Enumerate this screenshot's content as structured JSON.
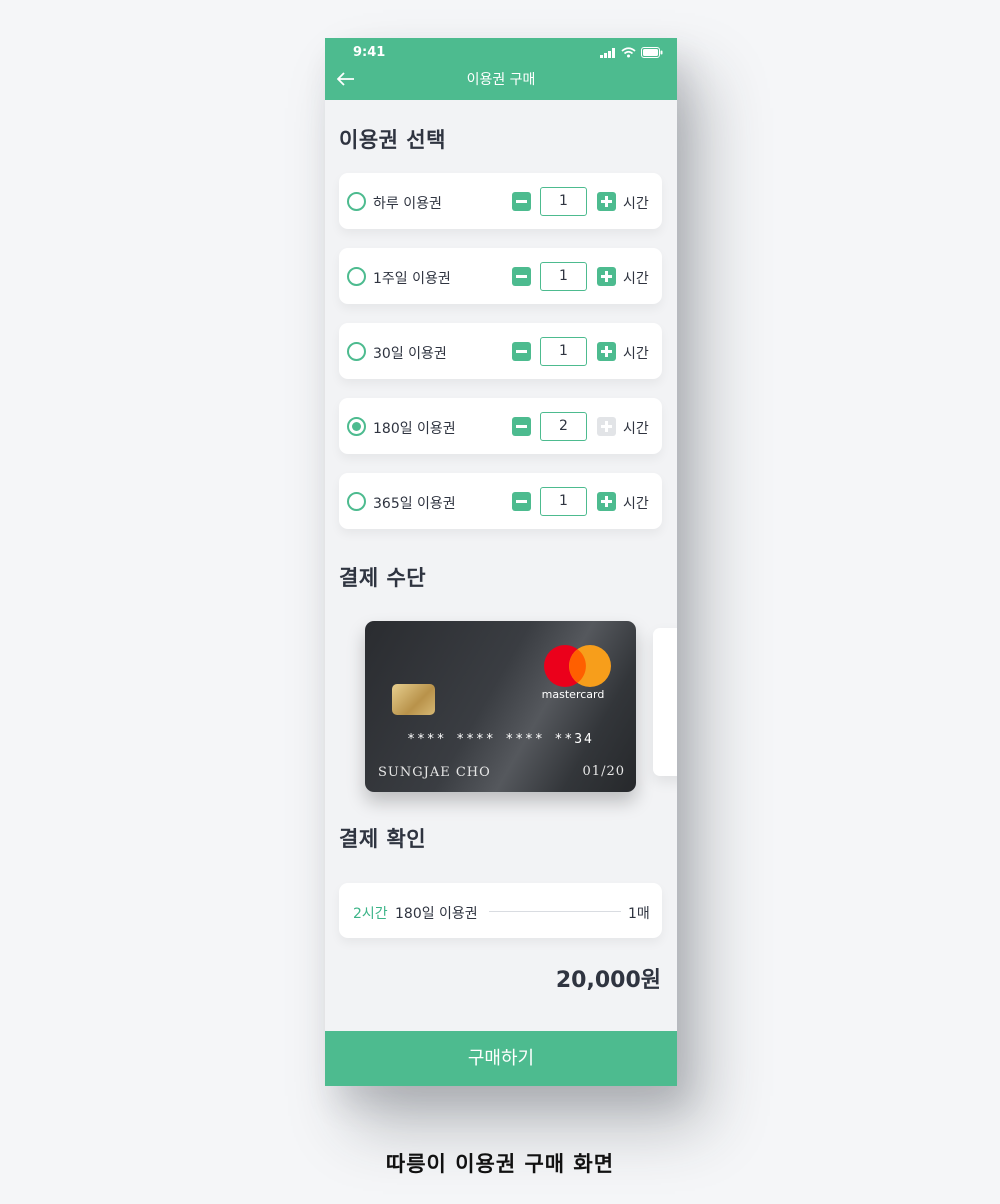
{
  "status_bar": {
    "time": "9:41"
  },
  "header": {
    "title": "이용권 구매",
    "back_icon": "back-arrow-icon"
  },
  "sections": {
    "ticket_select": "이용권 선택",
    "payment_method": "결제 수단",
    "payment_confirm": "결제 확인"
  },
  "tickets": [
    {
      "label": "하루 이용권",
      "qty": "1",
      "unit": "시간",
      "selected": false,
      "plus_enabled": true
    },
    {
      "label": "1주일 이용권",
      "qty": "1",
      "unit": "시간",
      "selected": false,
      "plus_enabled": true
    },
    {
      "label": "30일 이용권",
      "qty": "1",
      "unit": "시간",
      "selected": false,
      "plus_enabled": true
    },
    {
      "label": "180일 이용권",
      "qty": "2",
      "unit": "시간",
      "selected": true,
      "plus_enabled": false
    },
    {
      "label": "365일 이용권",
      "qty": "1",
      "unit": "시간",
      "selected": false,
      "plus_enabled": true
    }
  ],
  "card": {
    "brand": "mastercard",
    "number": "**** **** **** **34",
    "holder": "SUNGJAE CHO",
    "expiry": "01/20"
  },
  "summary": {
    "hours": "2시간",
    "ticket": "180일 이용권",
    "count": "1매",
    "total": "20,000원"
  },
  "buy_button": "구매하기",
  "caption": "따릉이 이용권 구매 화면",
  "colors": {
    "accent": "#4dbb8f",
    "background": "#f2f3f5"
  }
}
